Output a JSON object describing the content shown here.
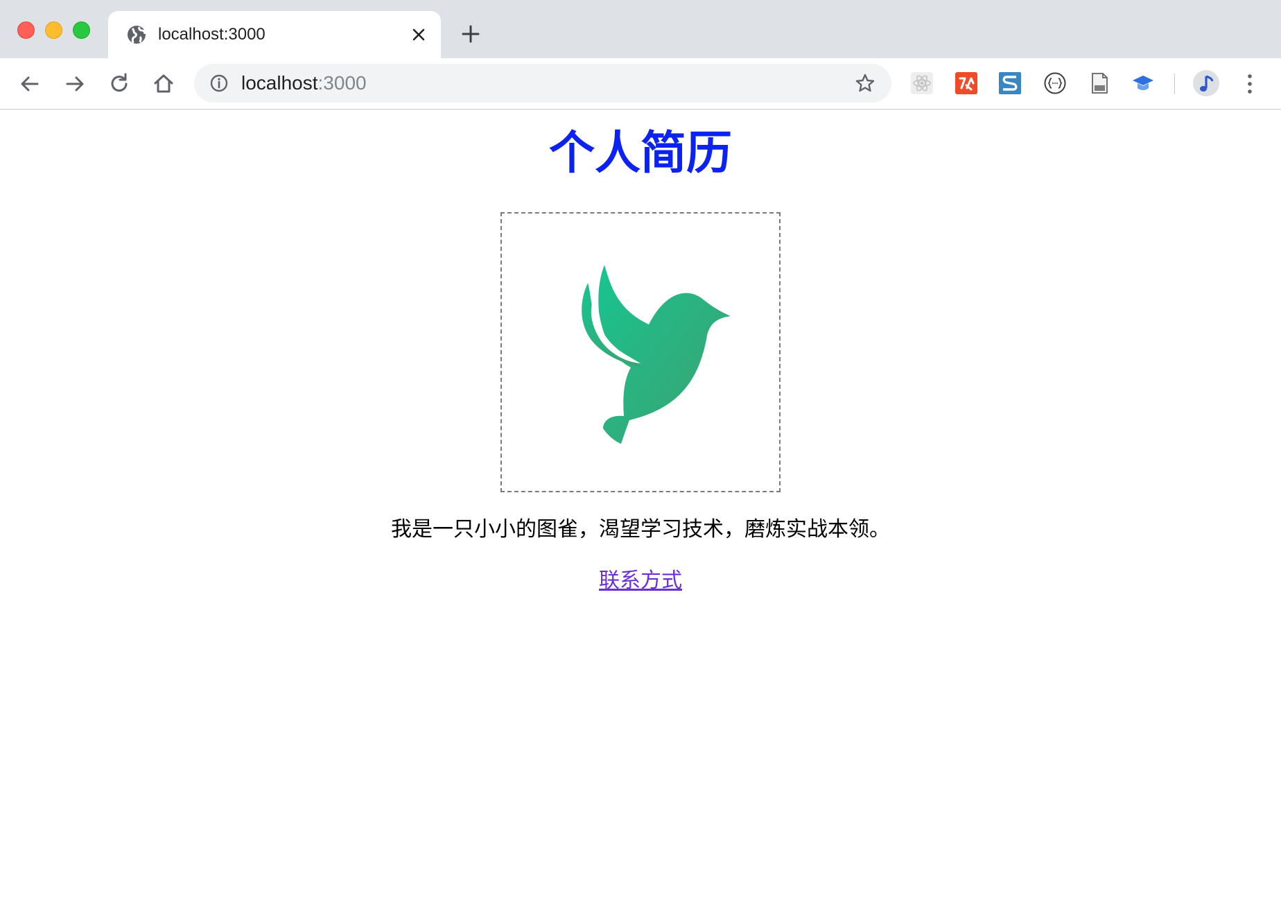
{
  "browser": {
    "window_controls": [
      "close",
      "minimize",
      "zoom"
    ],
    "tab": {
      "title": "localhost:3000",
      "favicon": "globe-icon",
      "close_icon": "close-icon"
    },
    "new_tab_icon": "plus-icon",
    "toolbar": {
      "back_icon": "arrow-left-icon",
      "forward_icon": "arrow-right-icon",
      "reload_icon": "reload-icon",
      "home_icon": "home-icon",
      "info_icon": "info-icon",
      "bookmark_icon": "star-icon",
      "extensions": [
        "react-devtools-icon",
        "red-extension-icon",
        "s-extension-icon",
        "json-viewer-icon",
        "document-icon",
        "graduation-cap-icon"
      ],
      "profile_icon": "profile-avatar-icon",
      "menu_icon": "kebab-menu-icon"
    },
    "address": {
      "host": "localhost",
      "port": ":3000"
    }
  },
  "page": {
    "title": "个人简历",
    "intro": "我是一只小小的图雀，渴望学习技术，磨炼实战本领。",
    "contact_link": "联系方式",
    "avatar_icon": "hummingbird-logo-icon"
  },
  "colors": {
    "title": "#0b22f0",
    "link": "#6b2fd6",
    "bird_start": "#1cc08e",
    "bird_end": "#3aa374",
    "tabstrip": "#dee1e6",
    "omnibox": "#f1f3f4"
  }
}
